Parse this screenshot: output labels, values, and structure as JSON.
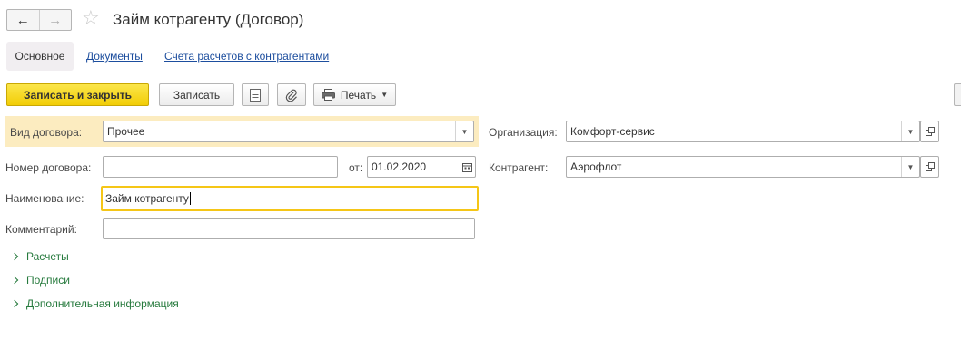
{
  "header": {
    "title": "Займ котрагенту (Договор)"
  },
  "tabs": [
    {
      "label": "Основное",
      "active": true
    },
    {
      "label": "Документы",
      "active": false
    },
    {
      "label": "Счета расчетов с контрагентами",
      "active": false
    }
  ],
  "toolbar": {
    "save_close_label": "Записать и закрыть",
    "save_label": "Записать",
    "print_label": "Печать",
    "icons": [
      "report-icon",
      "paperclip-icon",
      "printer-icon"
    ]
  },
  "form": {
    "contract_type": {
      "label": "Вид договора:",
      "value": "Прочее"
    },
    "organization": {
      "label": "Организация:",
      "value": "Комфорт-сервис"
    },
    "contract_number": {
      "label": "Номер договора:",
      "value": ""
    },
    "date": {
      "label": "от:",
      "value": "01.02.2020"
    },
    "counterparty": {
      "label": "Контрагент:",
      "value": "Аэрофлот"
    },
    "name": {
      "label": "Наименование:",
      "value": "Займ котрагенту"
    },
    "comment": {
      "label": "Комментарий:",
      "value": ""
    }
  },
  "groups": [
    {
      "label": "Расчеты"
    },
    {
      "label": "Подписи"
    },
    {
      "label": "Дополнительная информация"
    }
  ],
  "colors": {
    "primary_button": "#f2cd06",
    "highlight_row": "#fcecc0",
    "focus_border": "#f5c617",
    "link": "#1d4e9e",
    "group_link": "#267a3d"
  }
}
